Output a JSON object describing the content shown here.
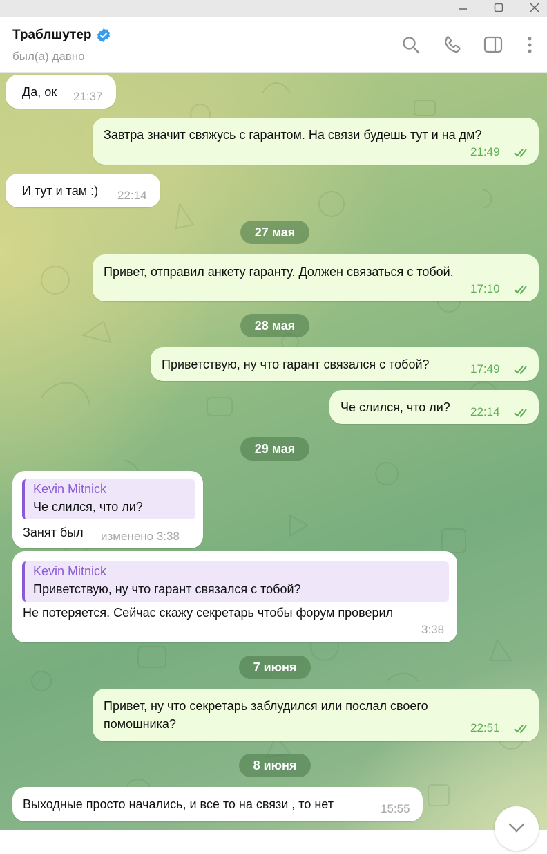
{
  "window": {
    "minimize_icon": "minimize-icon",
    "maximize_icon": "maximize-icon",
    "close_icon": "close-icon"
  },
  "header": {
    "title": "Траблшутер",
    "status": "был(а) давно",
    "icons": [
      "search-icon",
      "phone-icon",
      "sidebar-toggle-icon",
      "more-vertical-icon"
    ]
  },
  "colors": {
    "accent": "#3a9be8",
    "outgoing_bubble": "#effdde",
    "incoming_bubble": "#ffffff",
    "read_ticks": "#5fad58",
    "quote_accent": "#8a5bd6",
    "quote_background": "#efe6fa"
  },
  "messages": [
    {
      "direction": "in",
      "text": "Да, ок",
      "time": "21:37"
    },
    {
      "direction": "out",
      "text": "Завтра значит свяжусь с гарантом. На связи будешь тут и на дм?",
      "time": "21:49",
      "read": true
    },
    {
      "direction": "in",
      "text": "И тут и там :)",
      "time": "22:14"
    },
    {
      "type": "date",
      "text": "27 мая"
    },
    {
      "direction": "out",
      "text": "Привет, отправил анкету гаранту. Должен связаться с тобой.",
      "time": "17:10",
      "read": true
    },
    {
      "type": "date",
      "text": "28 мая"
    },
    {
      "direction": "out",
      "text": "Приветствую, ну что гарант связался с тобой?",
      "time": "17:49",
      "read": true
    },
    {
      "direction": "out",
      "text": "Че слился, что ли?",
      "time": "22:14",
      "read": true
    },
    {
      "type": "date",
      "text": "29 мая"
    },
    {
      "direction": "in",
      "reply_to": {
        "author": "Kevin Mitnick",
        "text": "Че слился, что ли?"
      },
      "text": "Занят был",
      "time": "изменено 3:38"
    },
    {
      "direction": "in",
      "reply_to": {
        "author": "Kevin Mitnick",
        "text": "Приветствую, ну что гарант связался с тобой?"
      },
      "text": "Не потеряется. Сейчас скажу секретарь чтобы форум проверил",
      "time": "3:38"
    },
    {
      "type": "date",
      "text": "7 июня"
    },
    {
      "direction": "out",
      "text_lines": [
        "Привет, ну что секретарь заблудился или послал своего",
        "помошника?"
      ],
      "time": "22:51",
      "read": true
    },
    {
      "type": "date",
      "text": "8 июня"
    },
    {
      "direction": "in",
      "text": "Выходные просто начались, и все то на связи , то нет",
      "time": "15:55"
    }
  ],
  "scroll_down_icon": "scroll-down-icon"
}
